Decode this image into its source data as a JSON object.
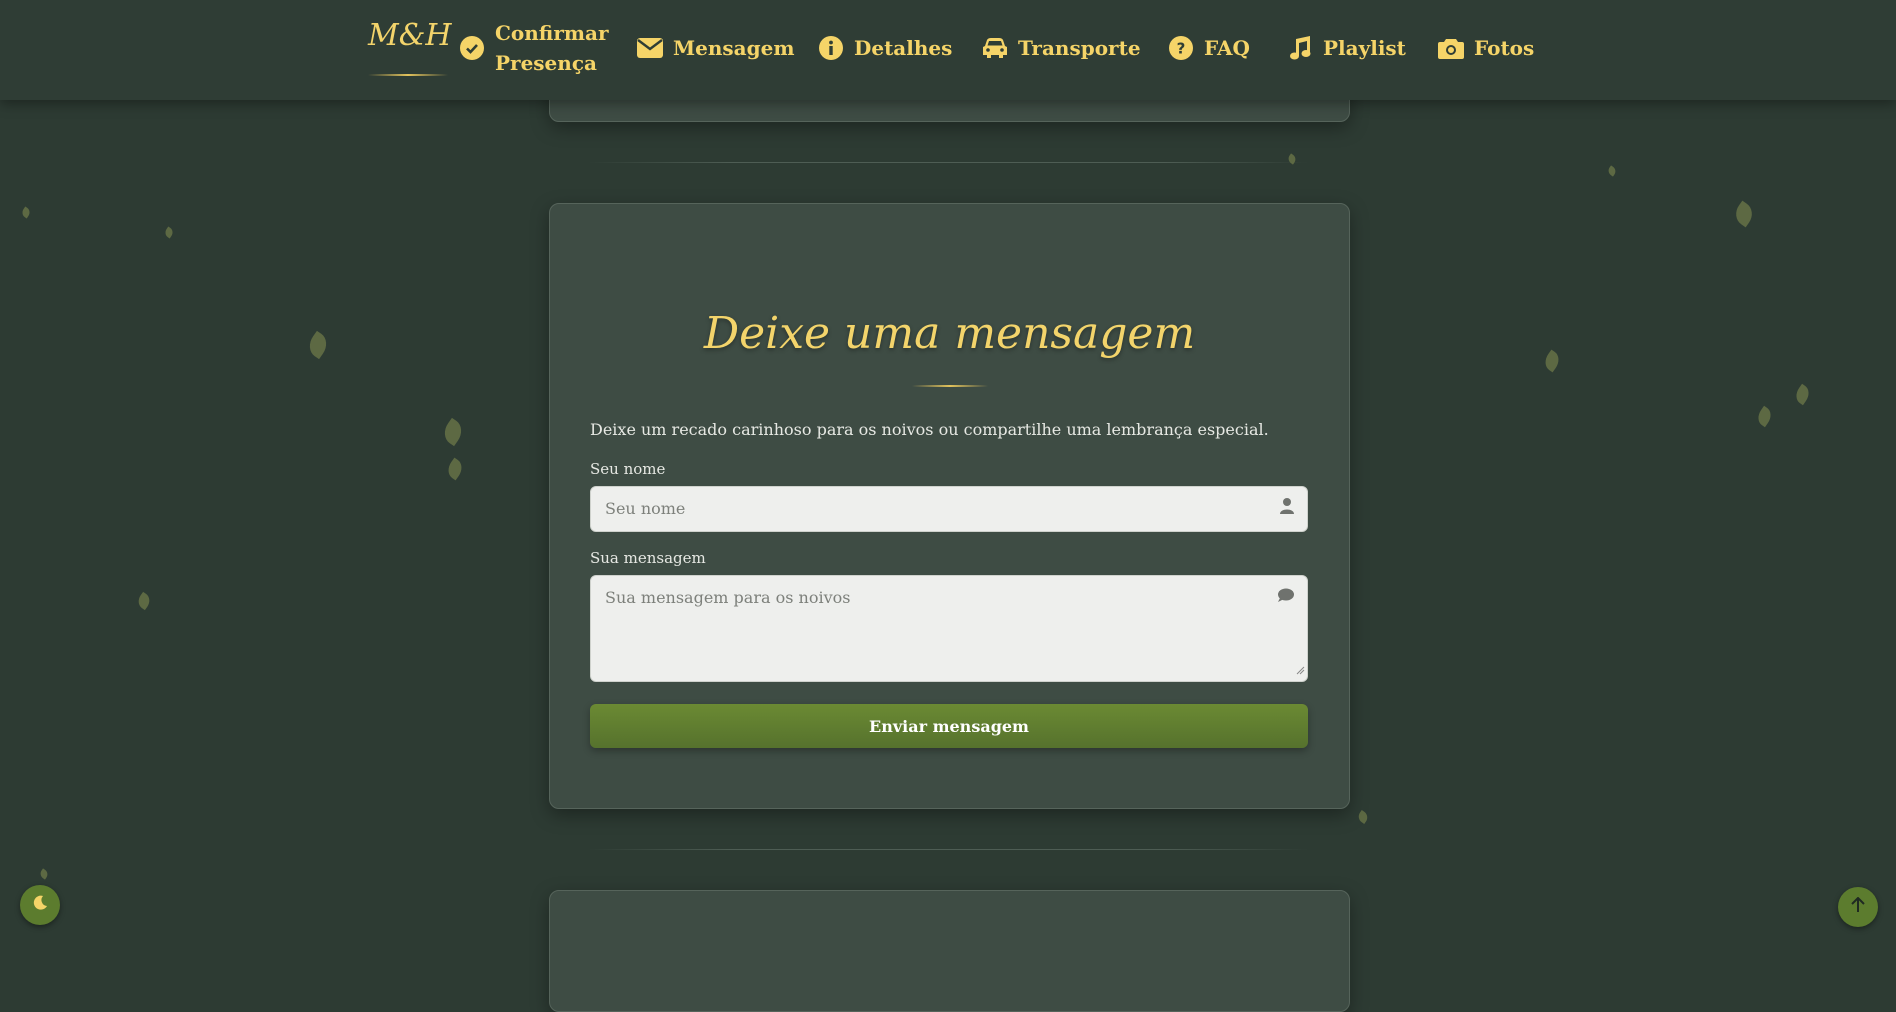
{
  "nav": {
    "logo": "M&H",
    "items": [
      {
        "label_line1": "Confirmar",
        "label_line2": "Presença",
        "icon": "check-circle-icon"
      },
      {
        "label": "Mensagem",
        "icon": "envelope-icon"
      },
      {
        "label": "Detalhes",
        "icon": "info-icon"
      },
      {
        "label": "Transporte",
        "icon": "car-icon"
      },
      {
        "label": "FAQ",
        "icon": "question-icon"
      },
      {
        "label": "Playlist",
        "icon": "music-icon"
      },
      {
        "label": "Fotos",
        "icon": "camera-icon"
      }
    ]
  },
  "message_section": {
    "title": "Deixe uma mensagem",
    "intro": "Deixe um recado carinhoso para os noivos ou compartilhe uma lembrança especial.",
    "name_label": "Seu nome",
    "name_placeholder": "Seu nome",
    "message_label": "Sua mensagem",
    "message_placeholder": "Sua mensagem para os noivos",
    "submit_label": "Enviar mensagem"
  },
  "controls": {
    "theme_toggle_icon": "moon-icon",
    "back_to_top_icon": "arrow-up-icon"
  },
  "colors": {
    "background": "#2d3b33",
    "card": "#3e4c44",
    "accent_gold": "#f3d46b",
    "button_green": "#6b8a33"
  }
}
